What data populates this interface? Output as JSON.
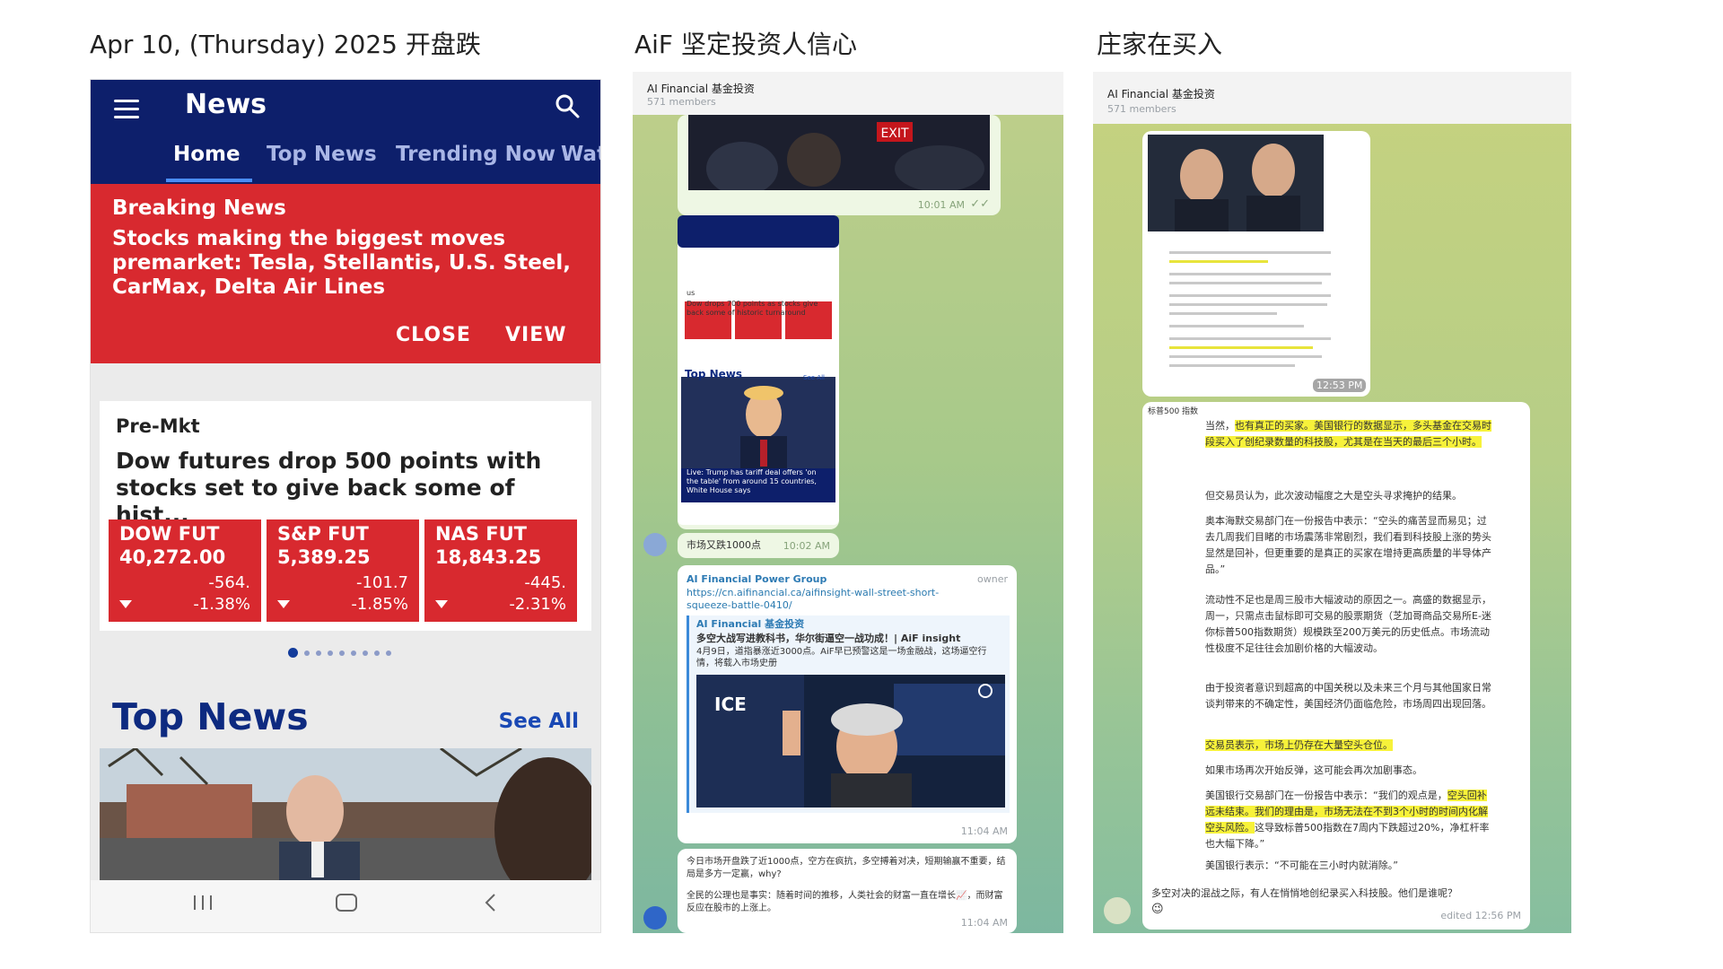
{
  "titles": {
    "col1": "Apr 10, (Thursday) 2025 开盘跌",
    "col2": "AiF 坚定投资人信心",
    "col3": "庄家在买入"
  },
  "news_app": {
    "app_title": "News",
    "tabs": [
      "Home",
      "Top News",
      "Trending Now",
      "Wat"
    ],
    "breaking": {
      "label": "Breaking News",
      "headline": "Stocks making the biggest moves premarket: Tesla, Stellantis, U.S. Steel, CarMax, Delta Air Lines",
      "close_label": "CLOSE",
      "view_label": "VIEW"
    },
    "premkt": {
      "label": "Pre-Mkt",
      "headline": "Dow futures drop 500 points with stocks set to give back some of hist...",
      "futures": [
        {
          "name": "DOW FUT",
          "value": "40,272.00",
          "change": "-564.",
          "pct": "-1.38%"
        },
        {
          "name": "S&P FUT",
          "value": "5,389.25",
          "change": "-101.7",
          "pct": "-1.85%"
        },
        {
          "name": "NAS FUT",
          "value": "18,843.25",
          "change": "-445.",
          "pct": "-2.31%"
        }
      ],
      "carousel_pages": 9,
      "carousel_active": 1
    },
    "top_news": {
      "title": "Top News",
      "see_all": "See All"
    },
    "colors": {
      "navy": "#0d1f6b",
      "red": "#d8292f",
      "blue_link": "#1948b4"
    }
  },
  "chat": {
    "group_name": "AI Financial 基金投资",
    "members": "571 members",
    "msg1_time": "10:01 AM",
    "mini_screenshot": {
      "section": "us",
      "headline": "Dow drops 700 points as stocks give back some of historic turnaround",
      "top_news": "Top News",
      "see_all": "See All",
      "caption": "Live: Trump has tariff deal offers 'on the table' from around 15 countries, White House says",
      "time": "10:02 AM"
    },
    "msg3_text": "市场又跌1000点",
    "msg3_time": "10:02 AM",
    "forward": {
      "sender": "AI Financial Power Group",
      "role": "owner",
      "link": "https://cn.aifinancial.ca/aifinsight-wall-street-short-squeeze-battle-0410/",
      "inner_channel": "AI Financial 基金投资",
      "inner_title": "多空大战写进教科书，华尔街逼空一战功成！| AiF insight",
      "inner_body": "4月9日，道指暴涨近3000点。AiF早已预警这是一场金融战，这场逼空行情，将载入市场史册",
      "time": "11:04 AM"
    },
    "msg5_p1": "今日市场开盘跌了近1000点，空方在疯抗，多空搏着对决，短期输赢不重要，结局是多方一定赢，why?",
    "msg5_p2": "全民的公理也是事实：随着时间的推移，人类社会的财富一直在增长📈，而财富反应在股市的上涨上。",
    "msg5_time": "11:04 AM"
  },
  "article": {
    "group_name": "AI Financial 基金投资",
    "members": "571 members",
    "image_time": "12:53 PM",
    "label": "标普500 指数",
    "paragraphs": [
      {
        "pre": "当然，",
        "hl": "也有真正的买家。美国银行的数据显示，多头基金在交易时段买入了创纪录数量的科技股，尤其是在当天的最后三个小时。",
        "post": ""
      },
      {
        "pre": "但交易员认为，此次波动幅度之大是空头寻求掩护的结果。",
        "hl": "",
        "post": ""
      },
      {
        "pre": "奥本海默交易部门在一份报告中表示：“空头的痛苦显而易见；过去几周我们目睹的市场震荡非常剧烈，我们看到科技股上涨的势头显然是回补，但更重要的是真正的买家在增持更高质量的半导体产品。”",
        "hl": "",
        "post": ""
      },
      {
        "pre": "流动性不足也是周三股市大幅波动的原因之一。高盛的数据显示，周一，只需点击鼠标即可交易的股票期货（芝加哥商品交易所E-迷你标普500指数期货）规模跌至200万美元的历史低点。市场流动性极度不足往往会加剧价格的大幅波动。",
        "hl": "",
        "post": ""
      },
      {
        "pre": "由于投资者意识到超高的中国关税以及未来三个月与其他国家日常谈判带来的不确定性，美国经济仍面临危险，市场周四出现回落。",
        "hl": "",
        "post": ""
      },
      {
        "pre": "",
        "hl": "交易员表示，市场上仍存在大量空头仓位。",
        "post": ""
      },
      {
        "pre": "如果市场再次开始反弹，这可能会再次加剧事态。",
        "hl": "",
        "post": ""
      },
      {
        "pre": "美国银行交易部门在一份报告中表示：“我们的观点是，",
        "hl": "空头回补远未结束。我们的理由是，市场无法在不到3个小时的时间内化解空头风险。",
        "post": "这导致标普500指数在7周内下跌超过20%，净杠杆率也大幅下降。”"
      },
      {
        "pre": "美国银行表示：“不可能在三小时内就消除。”",
        "hl": "",
        "post": ""
      }
    ],
    "footer_text": "多空对决的混战之际，有人在悄悄地创纪录买入科技股。他们是谁呢？",
    "footer_emoji": "😉",
    "footer_time": "edited 12:56 PM"
  }
}
